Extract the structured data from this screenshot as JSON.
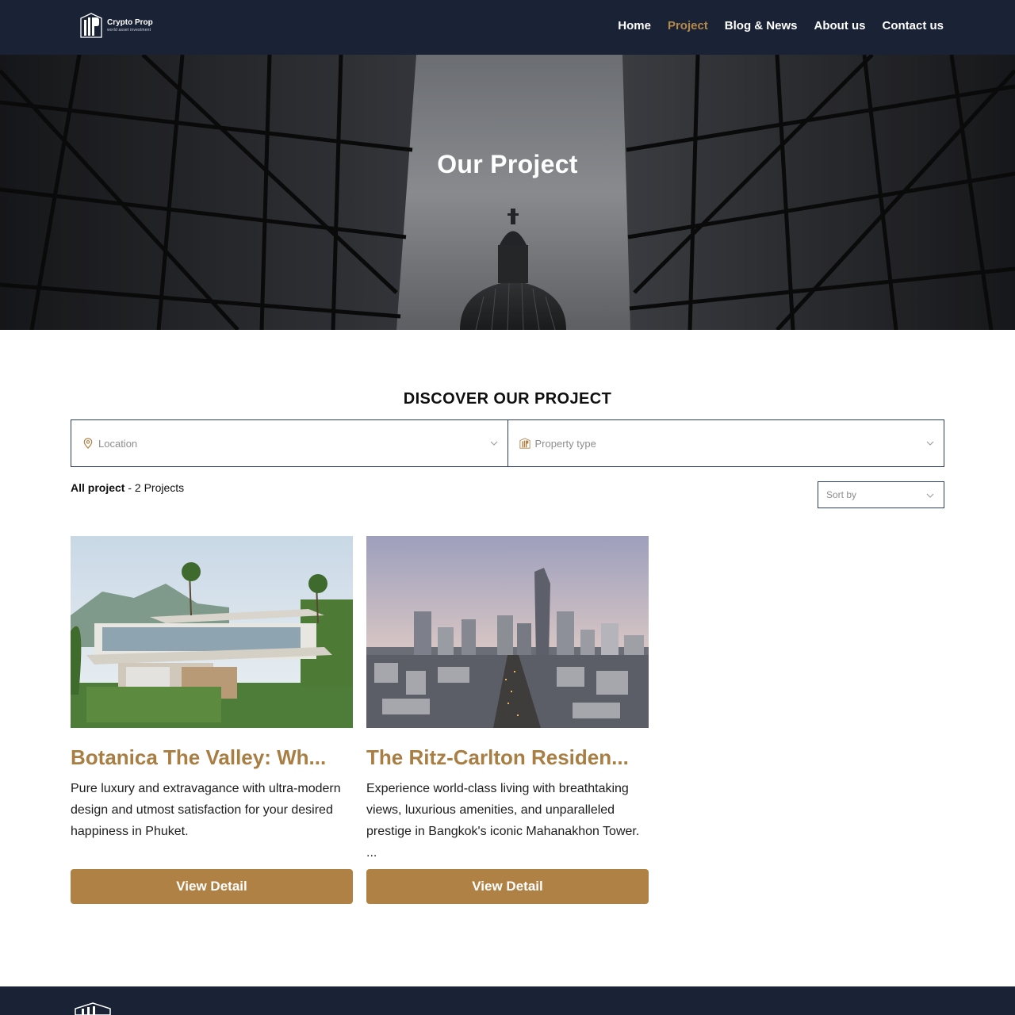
{
  "header": {
    "logo_name": "Crypto Prop",
    "logo_tagline": "world asset investment",
    "nav": [
      {
        "label": "Home"
      },
      {
        "label": "Project"
      },
      {
        "label": "Blog & News"
      },
      {
        "label": "About us"
      },
      {
        "label": "Contact us"
      }
    ],
    "active_nav": "Project"
  },
  "hero": {
    "title": "Our Project"
  },
  "discover": {
    "title": "DISCOVER OUR PROJECT",
    "location_placeholder": "Location",
    "property_type_placeholder": "Property type",
    "count_label": "All project",
    "count_value": "- 2 Projects",
    "sort_placeholder": "Sort by"
  },
  "projects": [
    {
      "title": "Botanica The Valley: Wh...",
      "description": "Pure luxury and extravagance with ultra-modern design and utmost satisfaction for your desired happiness in Phuket.",
      "button_label": "View Detail"
    },
    {
      "title": "The Ritz-Carlton Residen...",
      "description": "Experience world-class living with breathtaking views, luxurious amenities, and unparalleled prestige in Bangkok's iconic Mahanakhon Tower. ...",
      "button_label": "View Detail"
    }
  ],
  "colors": {
    "navy": "#1a2236",
    "gold": "#b08144",
    "gold_text": "#a97e43",
    "border_blue": "#2c3a66"
  },
  "icons": {
    "location": "location-pin-icon",
    "property_type": "building-icon",
    "dropdown": "chevron-down-icon"
  }
}
